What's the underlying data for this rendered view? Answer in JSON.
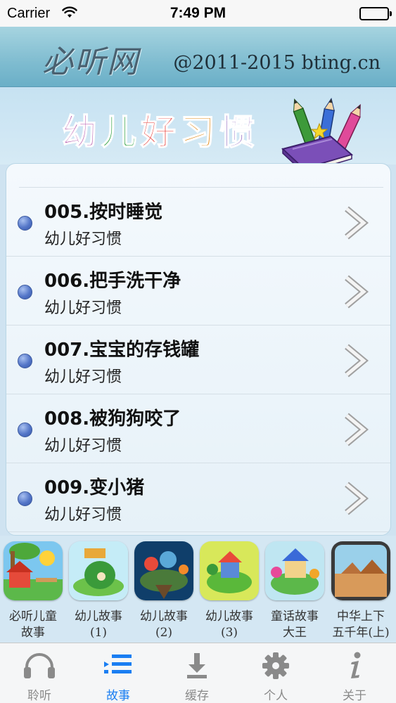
{
  "status_bar": {
    "carrier": "Carrier",
    "time": "7:49 PM",
    "wifi_icon": "wifi-icon",
    "battery_icon": "battery-icon"
  },
  "header": {
    "logo": "必听网",
    "copyright": "@2011-2015 bting.cn"
  },
  "banner": {
    "title": "幼儿好习惯",
    "title_chars": [
      "幼",
      "儿",
      "好",
      "习",
      "惯"
    ],
    "title_colors": [
      "#b44fa8",
      "#2e9f3e",
      "#e6312b",
      "#e28b1a",
      "#7a4ab4"
    ],
    "art_icon": "book-and-pencils-icon"
  },
  "list": {
    "items": [
      {
        "title": "005.按时睡觉",
        "subtitle": "幼儿好习惯"
      },
      {
        "title": "006.把手洗干净",
        "subtitle": "幼儿好习惯"
      },
      {
        "title": "007.宝宝的存钱罐",
        "subtitle": "幼儿好习惯"
      },
      {
        "title": "008.被狗狗咬了",
        "subtitle": "幼儿好习惯"
      },
      {
        "title": "009.变小猪",
        "subtitle": "幼儿好习惯"
      }
    ],
    "bullet_color": "#5476c8",
    "chevron_icon": "chevron-right-icon"
  },
  "apps": {
    "items": [
      {
        "line1": "必听儿童",
        "line2": "故事",
        "icon": "app-icon-kids-story"
      },
      {
        "line1": "幼儿故事",
        "line2": "(1)",
        "icon": "app-icon-young-story-1"
      },
      {
        "line1": "幼儿故事",
        "line2": "(2)",
        "icon": "app-icon-young-story-2"
      },
      {
        "line1": "幼儿故事",
        "line2": "(3)",
        "icon": "app-icon-young-story-3"
      },
      {
        "line1": "童话故事",
        "line2": "大王",
        "icon": "app-icon-fairy-tale-king"
      },
      {
        "line1": "中华上下",
        "line2": "五千年(上)",
        "icon": "app-icon-china-history"
      }
    ]
  },
  "tab_bar": {
    "active_color": "#1a7ef2",
    "inactive_color": "#8a8a8a",
    "tabs": [
      {
        "label": "聆听",
        "icon": "headphones-icon",
        "active": false
      },
      {
        "label": "故事",
        "icon": "list-icon",
        "active": true
      },
      {
        "label": "缓存",
        "icon": "download-icon",
        "active": false
      },
      {
        "label": "个人",
        "icon": "gear-icon",
        "active": false
      },
      {
        "label": "关于",
        "icon": "info-icon",
        "active": false
      }
    ]
  }
}
